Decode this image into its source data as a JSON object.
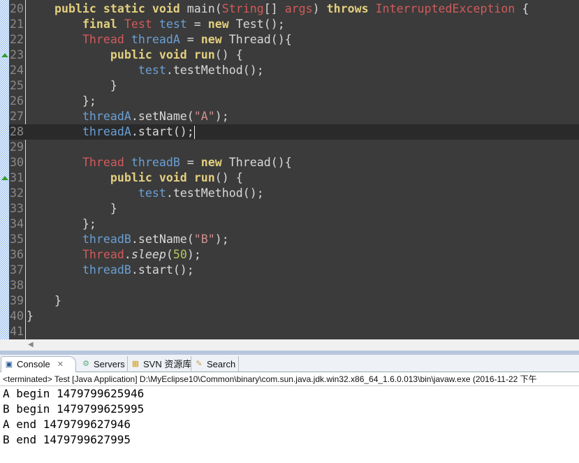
{
  "editor": {
    "current_line": 28,
    "lines": [
      {
        "n": "20",
        "t": [
          [
            "    "
          ],
          [
            "public static void ",
            "kw"
          ],
          [
            "main("
          ],
          [
            "String",
            "ty"
          ],
          [
            "[] "
          ],
          [
            "args",
            "ty"
          ],
          [
            ") "
          ],
          [
            "throws",
            "kw"
          ],
          [
            " "
          ],
          [
            "InterruptedException",
            "ty"
          ],
          [
            " {"
          ]
        ]
      },
      {
        "n": "21",
        "t": [
          [
            "        "
          ],
          [
            "final ",
            "kw"
          ],
          [
            "Test ",
            "ty"
          ],
          [
            "test",
            "va"
          ],
          [
            " = "
          ],
          [
            "new ",
            "kw"
          ],
          [
            "Test();"
          ]
        ]
      },
      {
        "n": "22",
        "t": [
          [
            "        "
          ],
          [
            "Thread ",
            "ty"
          ],
          [
            "threadA",
            "va"
          ],
          [
            " = "
          ],
          [
            "new ",
            "kw"
          ],
          [
            "Thread(){"
          ]
        ]
      },
      {
        "n": "23",
        "t": [
          [
            "            "
          ],
          [
            "public void ",
            "kw"
          ],
          [
            "run",
            "kw"
          ],
          [
            "() {"
          ]
        ]
      },
      {
        "n": "24",
        "t": [
          [
            "                "
          ],
          [
            "test",
            "va"
          ],
          [
            ".testMethod();"
          ]
        ]
      },
      {
        "n": "25",
        "t": [
          [
            "            }"
          ]
        ]
      },
      {
        "n": "26",
        "t": [
          [
            "        };"
          ]
        ]
      },
      {
        "n": "27",
        "t": [
          [
            "        "
          ],
          [
            "threadA",
            "va"
          ],
          [
            ".setName("
          ],
          [
            "\"A\"",
            "st"
          ],
          [
            ");"
          ]
        ]
      },
      {
        "n": "28",
        "t": [
          [
            "        "
          ],
          [
            "threadA",
            "va"
          ],
          [
            ".start();"
          ]
        ]
      },
      {
        "n": "29",
        "t": []
      },
      {
        "n": "30",
        "t": [
          [
            "        "
          ],
          [
            "Thread ",
            "ty"
          ],
          [
            "threadB",
            "va"
          ],
          [
            " = "
          ],
          [
            "new ",
            "kw"
          ],
          [
            "Thread(){"
          ]
        ]
      },
      {
        "n": "31",
        "t": [
          [
            "            "
          ],
          [
            "public void ",
            "kw"
          ],
          [
            "run",
            "kw"
          ],
          [
            "() {"
          ]
        ]
      },
      {
        "n": "32",
        "t": [
          [
            "                "
          ],
          [
            "test",
            "va"
          ],
          [
            ".testMethod();"
          ]
        ]
      },
      {
        "n": "33",
        "t": [
          [
            "            }"
          ]
        ]
      },
      {
        "n": "34",
        "t": [
          [
            "        };"
          ]
        ]
      },
      {
        "n": "35",
        "t": [
          [
            "        "
          ],
          [
            "threadB",
            "va"
          ],
          [
            ".setName("
          ],
          [
            "\"B\"",
            "st"
          ],
          [
            ");"
          ]
        ]
      },
      {
        "n": "36",
        "t": [
          [
            "        "
          ],
          [
            "Thread",
            "ty"
          ],
          [
            "."
          ],
          [
            "sleep",
            "it"
          ],
          [
            "("
          ],
          [
            "50",
            "nu"
          ],
          [
            ");"
          ]
        ]
      },
      {
        "n": "37",
        "t": [
          [
            "        "
          ],
          [
            "threadB",
            "va"
          ],
          [
            ".start();"
          ]
        ]
      },
      {
        "n": "38",
        "t": []
      },
      {
        "n": "39",
        "t": [
          [
            "    }"
          ]
        ]
      },
      {
        "n": "40",
        "t": [
          [
            "}"
          ]
        ]
      },
      {
        "n": "41",
        "t": []
      }
    ],
    "override_markers": [
      23,
      31
    ]
  },
  "tabs": [
    {
      "label": "Console",
      "icon": "console-icon",
      "active": true,
      "close": "✕"
    },
    {
      "label": "Servers",
      "icon": "servers-icon"
    },
    {
      "label": "SVN 资源库",
      "icon": "svn-repository-icon"
    },
    {
      "label": "Search",
      "icon": "search-icon"
    }
  ],
  "console": {
    "status": "<terminated> Test [Java Application] D:\\MyEclipse10\\Common\\binary\\com.sun.java.jdk.win32.x86_64_1.6.0.013\\bin\\javaw.exe (2016-11-22 下午",
    "output": [
      "A begin 1479799625946",
      "B begin 1479799625995",
      "A end 1479799627946",
      "B end 1479799627995"
    ]
  }
}
